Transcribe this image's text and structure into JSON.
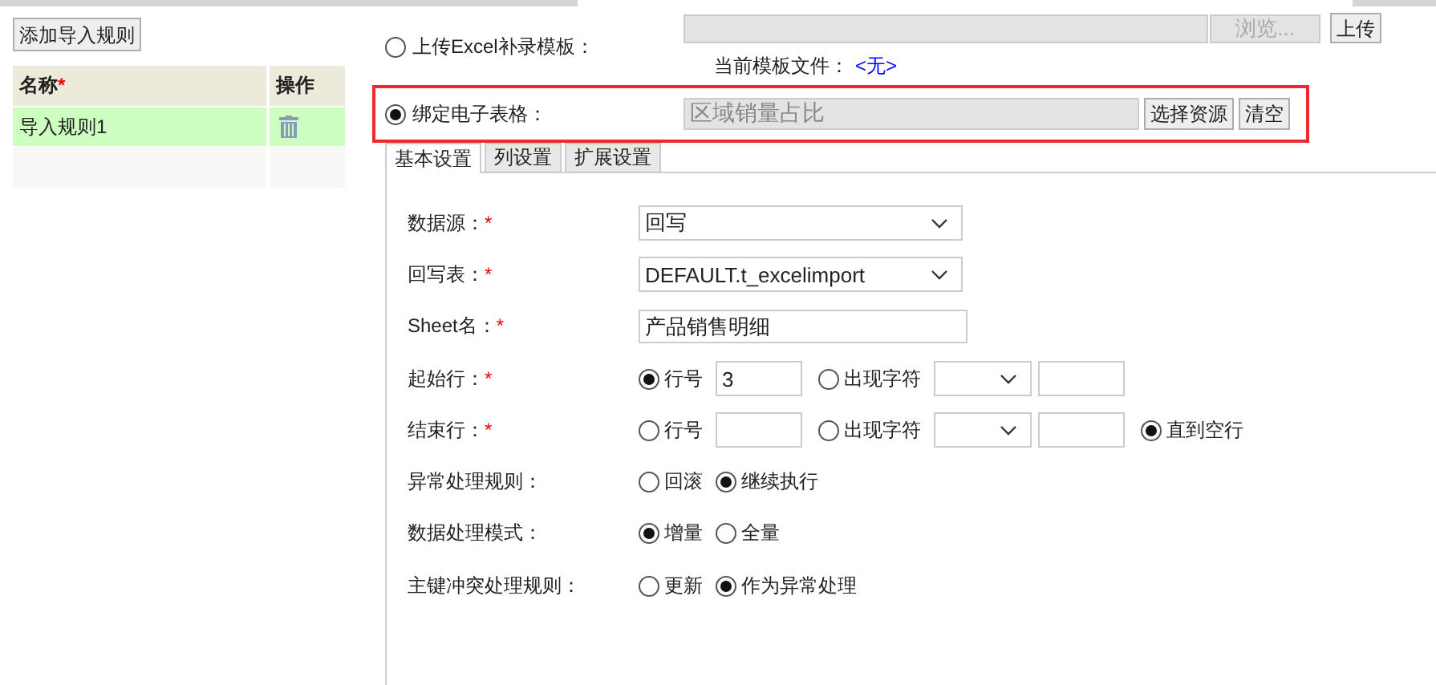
{
  "add_button": "添加导入规则",
  "rules_table": {
    "columns": [
      {
        "label": "名称",
        "required_mark": "*"
      },
      {
        "label": "操作"
      }
    ],
    "rows": [
      {
        "name": "导入规则1",
        "selected": true
      }
    ]
  },
  "source_options": [
    {
      "kind": "upload",
      "label": "上传Excel补录模板：",
      "selected": false,
      "highlighted": false,
      "disabled": true,
      "browse_button": "浏览...",
      "upload_button": "上传",
      "current_file_label": "当前模板文件：",
      "current_file": "<无>"
    },
    {
      "kind": "bind",
      "label": "绑定电子表格：",
      "selected": true,
      "highlighted": true,
      "disabled": true,
      "value": "区域销量占比",
      "buttons": [
        "选择资源",
        "清空"
      ]
    }
  ],
  "tabs": [
    {
      "label": "基本设置",
      "selected": true
    },
    {
      "label": "列设置",
      "selected": false
    },
    {
      "label": "扩展设置",
      "selected": false
    }
  ],
  "form": [
    {
      "kind": "select",
      "label": "数据源：",
      "required_mark": "*",
      "value": "回写"
    },
    {
      "kind": "select",
      "label": "回写表：",
      "required_mark": "*",
      "value": "DEFAULT.t_excelimport"
    },
    {
      "kind": "text",
      "label": "Sheet名：",
      "required_mark": "*",
      "value": "产品销售明细"
    },
    {
      "kind": "range",
      "label": "起始行：",
      "required_mark": "*",
      "options": [
        {
          "kind": "number",
          "label": "行号",
          "selected": true,
          "value": "3"
        },
        {
          "kind": "char",
          "label": "出现字符",
          "selected": false
        }
      ]
    },
    {
      "kind": "range",
      "label": "结束行：",
      "required_mark": "*",
      "options": [
        {
          "kind": "number",
          "label": "行号",
          "selected": false
        },
        {
          "kind": "char",
          "label": "出现字符",
          "selected": false
        },
        {
          "kind": "plain",
          "label": "直到空行",
          "selected": true
        }
      ]
    },
    {
      "kind": "radios",
      "label": "异常处理规则：",
      "options": [
        {
          "label": "回滚",
          "selected": false
        },
        {
          "label": "继续执行",
          "selected": true
        }
      ]
    },
    {
      "kind": "radios",
      "label": "数据处理模式：",
      "options": [
        {
          "label": "增量",
          "selected": true
        },
        {
          "label": "全量",
          "selected": false
        }
      ]
    },
    {
      "kind": "radios",
      "label": "主键冲突处理规则：",
      "options": [
        {
          "label": "更新",
          "selected": false
        },
        {
          "label": "作为异常处理",
          "selected": true
        }
      ]
    }
  ]
}
